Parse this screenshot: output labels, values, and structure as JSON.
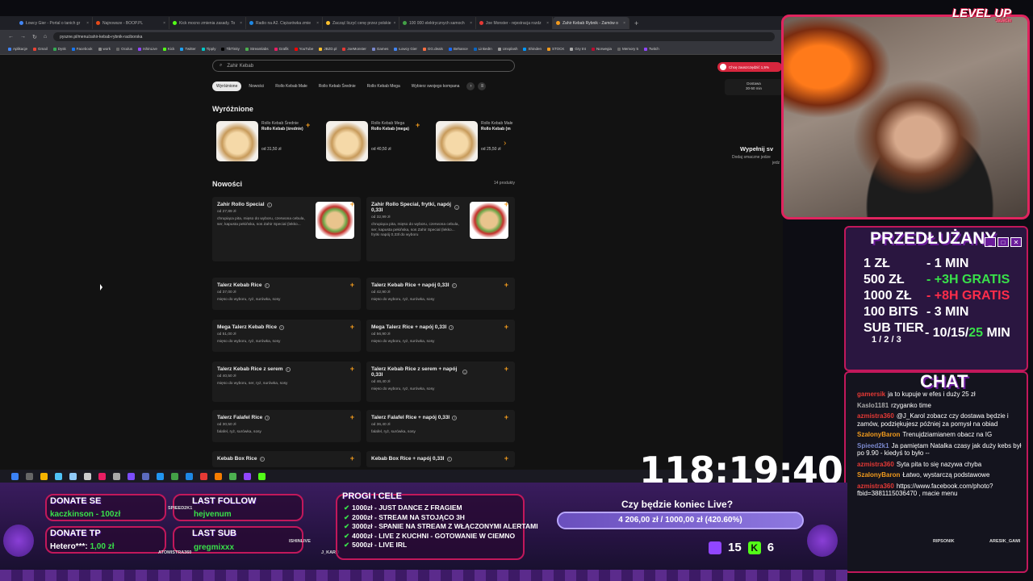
{
  "browser": {
    "tabs": [
      {
        "label": "Łowcy Gier - Portal o tanich gr",
        "color": "#4285f4"
      },
      {
        "label": "Najnowsze - BOOP.PL",
        "color": "#e64a19"
      },
      {
        "label": "Kick mocno zmienia zasady. To",
        "color": "#53fc18"
      },
      {
        "label": "Radio na A2. Ciężarówka zmie",
        "color": "#1e88e5"
      },
      {
        "label": "Zacząć liczyć cenę przez polskie",
        "color": "#fbc02d"
      },
      {
        "label": "100 000 elektrycznych samoch",
        "color": "#43a047"
      },
      {
        "label": "Joe Monster - rejestracja rozdz",
        "color": "#e53935"
      },
      {
        "label": "Zahir Kebab Rybnik - Zamów o",
        "color": "#f29b1d"
      }
    ],
    "url": "pyszne.pl/menu/zahir-kebab-rybnik-raciborska",
    "bookmarks": [
      "Aplikacje",
      "Gmail",
      "Dysk",
      "Facebook",
      "work",
      "Oculus",
      "IshinLive",
      "Kick",
      "Twitter",
      "Tipply",
      "TikTinity",
      "Streamlabs",
      "Grafik",
      "YouTube",
      "JBZD.pl",
      "JoeMonster",
      "Games",
      "Łowcy Gier",
      "GG.deals",
      "Behance",
      "LinkedIn",
      "Unsplash",
      "Shinden",
      "STOCK",
      "Gry tnt",
      "Norwegia",
      "Memory 5",
      "Twitch"
    ]
  },
  "page": {
    "search_placeholder": "Zahir Kebab",
    "categories": [
      "Wyróżnione",
      "Nowości",
      "Rollo Kebab Małe",
      "Rollo Kebab Średnie",
      "Rollo Kebab Mega",
      "Wybierz swojego kompana"
    ],
    "featured_title": "Wyróżnione",
    "featured": [
      {
        "cat": "Rollo Kebab Średnie",
        "name": "Rollo Kebab (średnie)",
        "price": "od 31,50 zł"
      },
      {
        "cat": "Rollo Kebab Mega",
        "name": "Rollo Kebab (mega)",
        "price": "od 40,50 zł"
      },
      {
        "cat": "Rollo Kebab Małe",
        "name": "Rollo Kebab (m",
        "price": "od 25,50 zł"
      }
    ],
    "new_title": "Nowości",
    "product_count": "14 produkty",
    "items": [
      {
        "name": "Zahir Rollo Special",
        "price": "od 27,89 zł",
        "desc": "chrupiąca pita, mięso do wyboru, czerwona cebula, ser, kapusta pekińska, sos Zahir Special (lekko..."
      },
      {
        "name": "Zahir Rollo Special, frytki, napój 0,33l",
        "price": "od 32,99 zł",
        "desc": "chrupiąca pita, mięso do wyboru, czerwona cebula, ser, kapusta pekińska, sos Zahir Special (lekko... frytki napój 0,33l do wyboru"
      },
      {
        "name": "Talerz Kebab Rice",
        "price": "od 37,00 zł",
        "desc": "mięso do wyboru, ryż, surówka, sosy"
      },
      {
        "name": "Talerz Kebab Rice + napój 0,33l",
        "price": "od 42,90 zł",
        "desc": "mięso do wyboru, ryż, surówka, sosy"
      },
      {
        "name": "Mega Talerz Kebab Rice",
        "price": "od 51,00 zł",
        "desc": "mięso do wyboru, ryż, surówka, sosy"
      },
      {
        "name": "Mega Talerz Rice + napój 0,33l",
        "price": "od 56,90 zł",
        "desc": "mięso do wyboru, ryż, surówka, sosy"
      },
      {
        "name": "Talerz Kebab Rice z serem",
        "price": "od 40,50 zł",
        "desc": "mięso do wyboru, ser, ryż, surówka, sosy"
      },
      {
        "name": "Talerz Kebab Rice z serem + napój 0,33l",
        "price": "od 46,40 zł",
        "desc": "mięso do wyboru, ryż, surówka, sosy"
      },
      {
        "name": "Talerz Falafel Rice",
        "price": "od 30,50 zł",
        "desc": "falafel, ryż, surówka, sosy"
      },
      {
        "name": "Talerz Falafel Rice + napój 0,33l",
        "price": "od 36,40 zł",
        "desc": "falafel, ryż, surówka, sosy"
      },
      {
        "name": "Kebab Box Rice",
        "price": "",
        "desc": ""
      },
      {
        "name": "Kebab Box Rice + napój 0,33l",
        "price": "",
        "desc": ""
      }
    ],
    "promo": "Chcę zaoszczędzić 1,5%",
    "delivery": "Dostawa",
    "delivery_time": "30-50 min",
    "cart_title": "Wypełnij sv",
    "cart_sub": "Dodaj smaczne jedze",
    "cart_sub2": "jedz"
  },
  "overlay": {
    "levelup": "LEVEL UP",
    "levelup_sub": "JaJeCki",
    "przedluzany": "PRZEDŁUŻANY",
    "rows": [
      {
        "left": "1 ZŁ",
        "right": "- 1 MIN",
        "style": ""
      },
      {
        "left": "500 ZŁ",
        "right": "- +3H GRATIS",
        "style": "g"
      },
      {
        "left": "1000 ZŁ",
        "right": "- +8H GRATIS",
        "style": "r"
      },
      {
        "left": "100 BITS",
        "right": "- 3 MIN",
        "style": ""
      }
    ],
    "sub_tier": "SUB TIER",
    "sub_tiers": "1 / 2 / 3",
    "sub_values_a": "- 10/15/",
    "sub_values_b": "25",
    "sub_values_c": " MIN",
    "chat_title": "CHAT",
    "chat": [
      {
        "user": "gamersik",
        "color": "#e53935",
        "text": "ja to kupuje w efes i duży 25 zł"
      },
      {
        "user": "Kaslo1181",
        "color": "#aaaaaa",
        "text": "rzyganko time"
      },
      {
        "user": "azmistra360",
        "color": "#e53935",
        "text": "@J_Karol zobacz czy dostawa będzie i zamów, podziękujesz później za pomysł na obiad"
      },
      {
        "user": "SzalonyBaron",
        "color": "#f29b1d",
        "text": "Trenujdziamianem obacz na IG"
      },
      {
        "user": "Spieed2k1",
        "color": "#7986cb",
        "text": "Ja pamiętam Natalka czasy jak duży kebs był po 9.90 - kiedyś to było --"
      },
      {
        "user": "azmistra360",
        "color": "#e53935",
        "text": "Syta pita to się nazywa chyba"
      },
      {
        "user": "SzalonyBaron",
        "color": "#f29b1d",
        "text": "Łatwo, wystarczą podstawowe"
      },
      {
        "user": "azmistra360",
        "color": "#e53935",
        "text": "https://www.facebook.com/photo?fbid=3881115036470 , macie menu"
      }
    ],
    "timer": "118:19:40",
    "donate_se_label": "DONATE SE",
    "donate_se_value": "kaczkinson - 100zł",
    "donate_tp_label": "DONATE TP",
    "donate_tp_user": "Hetero***: ",
    "donate_tp_amount": "1,00 zł",
    "last_follow_label": "LAST FOLLOW",
    "last_follow_value": "hejvenum",
    "last_sub_label": "LAST SUB",
    "last_sub_value": "gregmixxx",
    "tag_spieed": "SPIEED2K1",
    "tag_atomistr": "ATOMISTRA360",
    "tag_ishin": "ISHINLIVE",
    "tag_jkaro": "J_KARO",
    "goals_title": "PROGI I CELE",
    "goals": [
      "1000zł - JUST DANCE Z FRAGIEM",
      "2000zł - STREAM NA STOJĄCO 3H",
      "3000zł - SPANIE NA STREAM Z WŁĄCZONYMI ALERTAMI",
      "4000zł - LIVE Z KUCHNI - GOTOWANIE W CIEMNO",
      "5000zł - LIVE IRL"
    ],
    "question": "Czy będzie koniec Live?",
    "progress_text": "4 206,00 zł / 1000,00 zł (420.60%)",
    "progress_fraction": 1.0,
    "count_twitch": "15",
    "count_kick": "6",
    "tag_ripsonik": "RIPSONIK",
    "tag_ares": "ARESIK_GAMI"
  }
}
